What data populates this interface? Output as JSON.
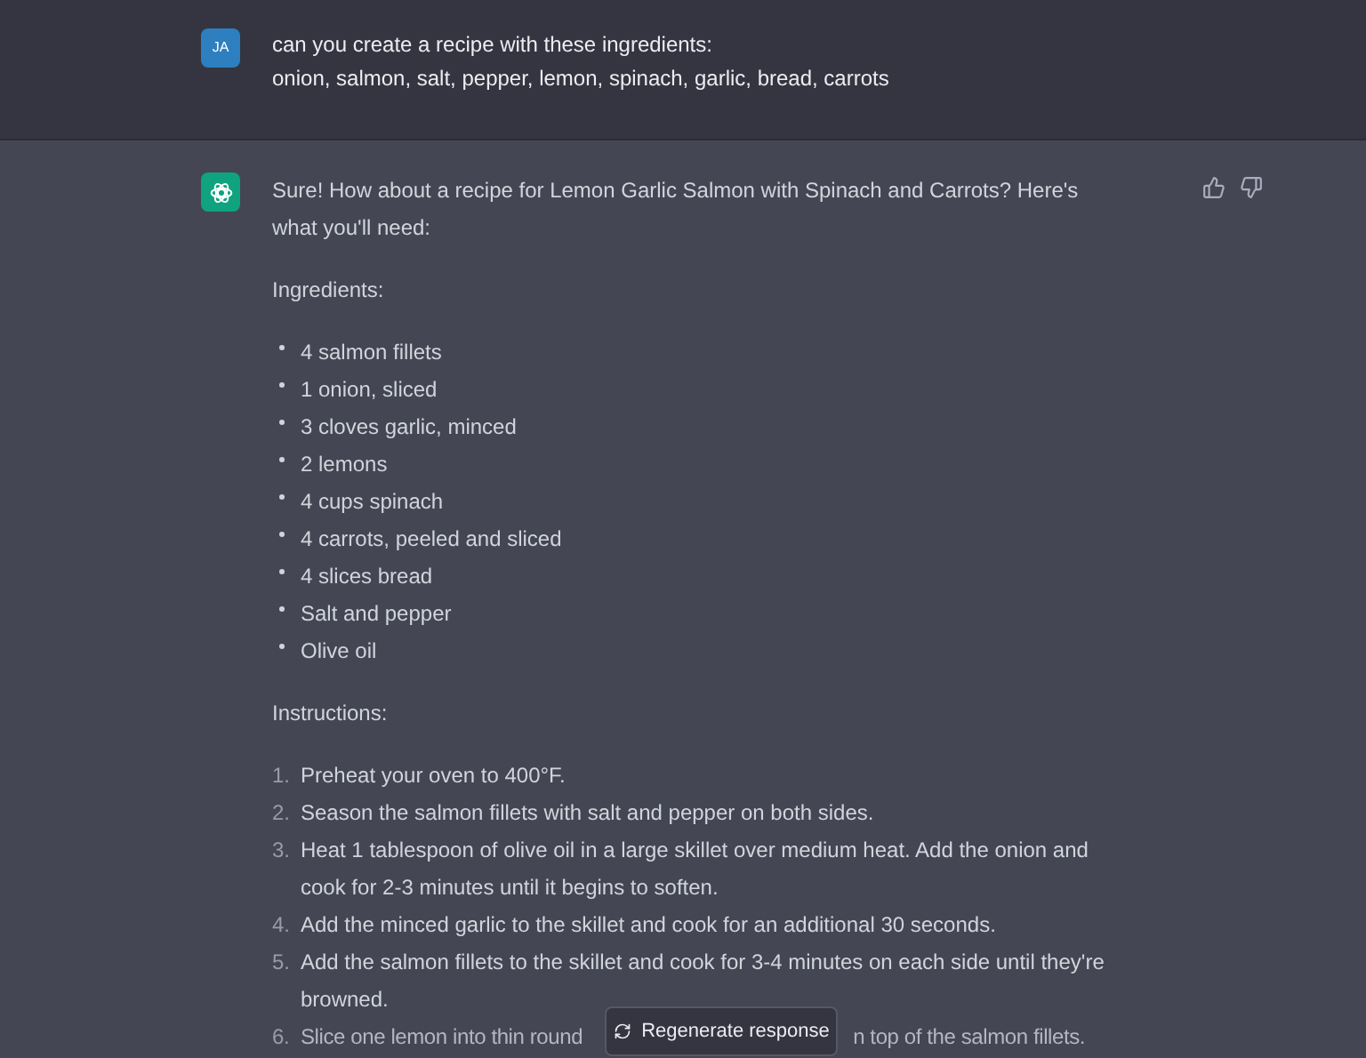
{
  "user_message": {
    "avatar": "JA",
    "lines": [
      "can you create a recipe with these ingredients:",
      "onion, salmon, salt, pepper, lemon, spinach, garlic, bread, carrots"
    ]
  },
  "reply": {
    "intro": "Sure! How about a recipe for Lemon Garlic Salmon with Spinach and Carrots? Here's what you'll need:",
    "ingredients_heading": "Ingredients:",
    "ingredients": [
      "4 salmon fillets",
      "1 onion, sliced",
      "3 cloves garlic, minced",
      "2 lemons",
      "4 cups spinach",
      "4 carrots, peeled and sliced",
      "4 slices bread",
      "Salt and pepper",
      "Olive oil"
    ],
    "instructions_heading": "Instructions:",
    "steps": [
      {
        "number": "1.",
        "parts": [
          "Preheat your oven to 400°F."
        ]
      },
      {
        "number": "2.",
        "parts": [
          "Season the salmon fillets with salt and pepper on both sides."
        ]
      },
      {
        "number": "3.",
        "parts": [
          "Heat 1 tablespoon of olive oil in a large skillet over medium heat. Add the onion and cook for 2-3 minutes until it begins to soften."
        ]
      },
      {
        "number": "4.",
        "parts": [
          "Add the minced garlic to the skillet and cook for an additional 30 seconds."
        ]
      },
      {
        "number": "5.",
        "parts": [
          "Add the salmon fillets to the skillet and cook for 3-4 minutes on each side until they're browned."
        ]
      },
      {
        "number": "6.",
        "parts": [
          "Slice one lemon into thin round",
          "n top of the salmon fillets."
        ]
      }
    ]
  },
  "regenerate_button": "Regenerate response"
}
